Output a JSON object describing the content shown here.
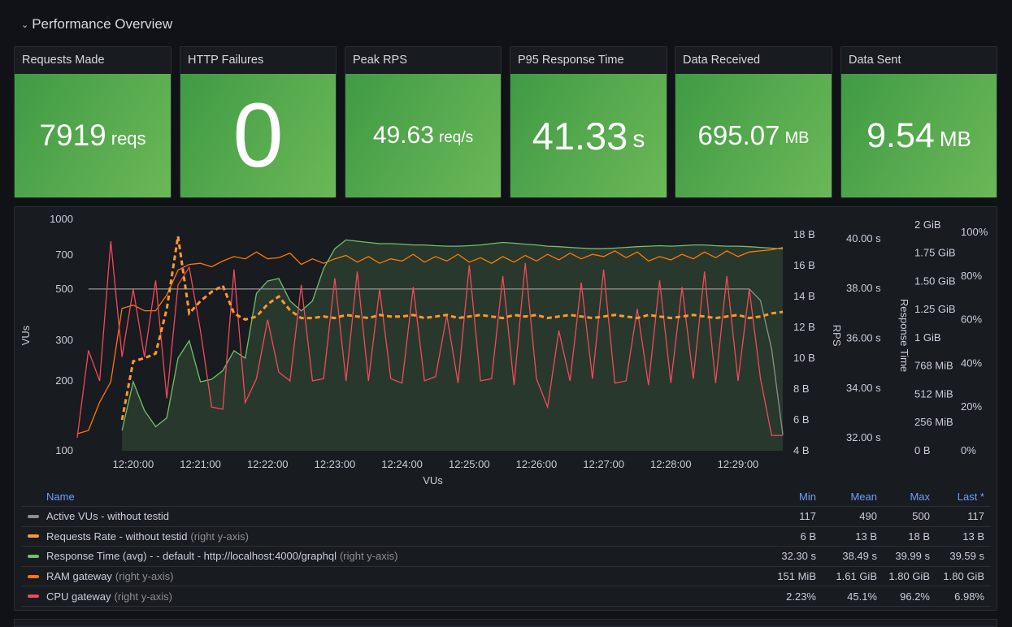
{
  "row": {
    "title": "Performance Overview",
    "icon": "chevron-down-icon"
  },
  "stats": [
    {
      "title": "Requests Made",
      "value": "7919",
      "unit": "reqs"
    },
    {
      "title": "HTTP Failures",
      "value": "0",
      "unit": ""
    },
    {
      "title": "Peak RPS",
      "value": "49.63",
      "unit": "req/s"
    },
    {
      "title": "P95 Response Time",
      "value": "41.33",
      "unit": "s"
    },
    {
      "title": "Data Received",
      "value": "695.07",
      "unit": "MB"
    },
    {
      "title": "Data Sent",
      "value": "9.54",
      "unit": "MB"
    }
  ],
  "colors": {
    "stat_green": "#56a94e",
    "vus": "#8e8e8e",
    "rps": "#FF9830",
    "resp": "#73BF69",
    "ram": "#FF780A",
    "cpu": "#F2495C",
    "legend_header": "#6e9fff"
  },
  "chart_data": {
    "type": "line",
    "xlabel": "VUs",
    "xlim": [
      "12:19:10",
      "12:29:45"
    ],
    "xticks": [
      "12:20:00",
      "12:21:00",
      "12:22:00",
      "12:23:00",
      "12:24:00",
      "12:25:00",
      "12:26:00",
      "12:27:00",
      "12:28:00",
      "12:29:00"
    ],
    "axes": {
      "vus": {
        "label": "VUs",
        "scale": "log",
        "range": [
          100,
          1000
        ],
        "ticks": [
          {
            "v": 100,
            "t": "100"
          },
          {
            "v": 200,
            "t": "200"
          },
          {
            "v": 300,
            "t": "300"
          },
          {
            "v": 500,
            "t": "500"
          },
          {
            "v": 700,
            "t": "700"
          },
          {
            "v": 1000,
            "t": "1000"
          }
        ]
      },
      "rps": {
        "label": "RPS",
        "range": [
          4,
          19
        ],
        "ticks": [
          {
            "v": 4,
            "t": "4 B"
          },
          {
            "v": 6,
            "t": "6 B"
          },
          {
            "v": 8,
            "t": "8 B"
          },
          {
            "v": 10,
            "t": "10 B"
          },
          {
            "v": 12,
            "t": "12 B"
          },
          {
            "v": 14,
            "t": "14 B"
          },
          {
            "v": 16,
            "t": "16 B"
          },
          {
            "v": 18,
            "t": "18 B"
          }
        ]
      },
      "resp": {
        "label": "Response Time",
        "range": [
          31.48,
          40.78
        ],
        "ticks": [
          {
            "v": 32,
            "t": "32.00 s"
          },
          {
            "v": 34,
            "t": "34.00 s"
          },
          {
            "v": 36,
            "t": "36.00 s"
          },
          {
            "v": 38,
            "t": "38.00 s"
          },
          {
            "v": 40,
            "t": "40.00 s"
          }
        ]
      },
      "ram": {
        "label": "",
        "range": [
          0,
          2.05
        ],
        "ticks": [
          {
            "v": 0,
            "t": "0 B"
          },
          {
            "v": 0.25,
            "t": "256 MiB"
          },
          {
            "v": 0.5,
            "t": "512 MiB"
          },
          {
            "v": 0.75,
            "t": "768 MiB"
          },
          {
            "v": 1,
            "t": "1 GiB"
          },
          {
            "v": 1.25,
            "t": "1.25 GiB"
          },
          {
            "v": 1.5,
            "t": "1.50 GiB"
          },
          {
            "v": 1.75,
            "t": "1.75 GiB"
          },
          {
            "v": 2,
            "t": "2 GiB"
          }
        ]
      },
      "cpu": {
        "label": "",
        "range": [
          0,
          106
        ],
        "ticks": [
          {
            "v": 0,
            "t": "0%"
          },
          {
            "v": 20,
            "t": "20%"
          },
          {
            "v": 40,
            "t": "40%"
          },
          {
            "v": 60,
            "t": "60%"
          },
          {
            "v": 80,
            "t": "80%"
          },
          {
            "v": 100,
            "t": "100%"
          }
        ]
      }
    },
    "x": [
      "12:19:10",
      "12:19:20",
      "12:19:30",
      "12:19:40",
      "12:19:50",
      "12:20:00",
      "12:20:10",
      "12:20:20",
      "12:20:30",
      "12:20:40",
      "12:20:50",
      "12:21:00",
      "12:21:10",
      "12:21:20",
      "12:21:30",
      "12:21:40",
      "12:21:50",
      "12:22:00",
      "12:22:10",
      "12:22:20",
      "12:22:30",
      "12:22:40",
      "12:22:50",
      "12:23:00",
      "12:23:10",
      "12:23:20",
      "12:23:30",
      "12:23:40",
      "12:23:50",
      "12:24:00",
      "12:24:10",
      "12:24:20",
      "12:24:30",
      "12:24:40",
      "12:24:50",
      "12:25:00",
      "12:25:10",
      "12:25:20",
      "12:25:30",
      "12:25:40",
      "12:25:50",
      "12:26:00",
      "12:26:10",
      "12:26:20",
      "12:26:30",
      "12:26:40",
      "12:26:50",
      "12:27:00",
      "12:27:10",
      "12:27:20",
      "12:27:30",
      "12:27:40",
      "12:27:50",
      "12:28:00",
      "12:28:10",
      "12:28:20",
      "12:28:30",
      "12:28:40",
      "12:28:50",
      "12:29:00",
      "12:29:10",
      "12:29:20",
      "12:29:30",
      "12:29:40"
    ],
    "series": [
      {
        "name": "Active VUs - without testid",
        "axis": "vus",
        "style": "line",
        "values": [
          null,
          500,
          500,
          500,
          500,
          500,
          500,
          500,
          500,
          500,
          500,
          500,
          500,
          500,
          500,
          500,
          500,
          500,
          500,
          500,
          500,
          500,
          500,
          500,
          500,
          500,
          500,
          500,
          500,
          500,
          500,
          500,
          500,
          500,
          500,
          500,
          500,
          500,
          500,
          500,
          500,
          500,
          500,
          500,
          500,
          500,
          500,
          500,
          500,
          500,
          500,
          500,
          500,
          500,
          500,
          500,
          500,
          500,
          500,
          500,
          500,
          446,
          275,
          117
        ]
      },
      {
        "name": "Requests Rate - without testid",
        "axis": "rps",
        "style": "dashed",
        "values": [
          null,
          null,
          null,
          null,
          6.0,
          9.8,
          10.0,
          10.3,
          13.2,
          17.9,
          12.9,
          13.7,
          14.3,
          14.7,
          12.9,
          12.5,
          12.7,
          13.5,
          14.0,
          13.1,
          12.6,
          12.6,
          12.7,
          12.6,
          12.8,
          12.7,
          12.6,
          12.8,
          12.7,
          12.7,
          12.8,
          12.6,
          12.7,
          12.8,
          12.6,
          12.7,
          12.8,
          12.7,
          12.6,
          12.8,
          12.7,
          12.8,
          12.6,
          12.7,
          12.8,
          12.7,
          12.6,
          12.7,
          12.8,
          12.7,
          12.6,
          12.8,
          12.7,
          12.6,
          12.7,
          12.8,
          12.7,
          12.6,
          12.7,
          12.8,
          12.6,
          12.7,
          12.9,
          13.0
        ]
      },
      {
        "name": "Response Time (avg) - - default - http://localhost:4000/graphql",
        "axis": "resp",
        "style": "area",
        "values": [
          null,
          null,
          null,
          null,
          32.3,
          34.25,
          33.1,
          32.45,
          32.8,
          35.2,
          35.9,
          34.25,
          34.35,
          34.7,
          35.5,
          35.2,
          37.8,
          38.3,
          38.4,
          37.5,
          37.1,
          37.5,
          38.8,
          39.6,
          39.95,
          39.9,
          39.85,
          39.8,
          39.8,
          39.78,
          39.75,
          39.75,
          39.72,
          39.7,
          39.7,
          39.72,
          39.75,
          39.8,
          39.85,
          39.82,
          39.78,
          39.75,
          39.7,
          39.68,
          39.65,
          39.62,
          39.6,
          39.6,
          39.62,
          39.65,
          39.68,
          39.7,
          39.72,
          39.7,
          39.72,
          39.75,
          39.75,
          39.72,
          39.7,
          39.7,
          39.68,
          39.65,
          39.62,
          39.59
        ]
      },
      {
        "name": "RAM gateway",
        "axis": "ram",
        "style": "line",
        "values": [
          0.15,
          0.18,
          0.43,
          0.61,
          1.26,
          1.29,
          1.24,
          1.24,
          1.38,
          1.6,
          1.65,
          1.66,
          1.63,
          1.68,
          1.72,
          1.7,
          1.76,
          1.7,
          1.71,
          1.75,
          1.65,
          1.7,
          1.66,
          1.7,
          1.73,
          1.67,
          1.72,
          1.66,
          1.7,
          1.68,
          1.74,
          1.67,
          1.72,
          1.68,
          1.74,
          1.67,
          1.71,
          1.66,
          1.72,
          1.67,
          1.73,
          1.68,
          1.74,
          1.69,
          1.75,
          1.7,
          1.74,
          1.72,
          1.77,
          1.71,
          1.76,
          1.68,
          1.72,
          1.69,
          1.74,
          1.7,
          1.76,
          1.71,
          1.77,
          1.72,
          1.76,
          1.77,
          1.78,
          1.8
        ]
      },
      {
        "name": "CPU gateway",
        "axis": "cpu",
        "style": "line",
        "values": [
          6,
          46,
          32,
          96,
          43,
          74,
          43,
          78,
          24,
          76,
          84,
          55,
          20,
          19,
          83,
          22,
          33,
          60,
          36,
          32,
          76,
          32,
          33,
          79,
          32,
          82,
          32,
          74,
          33,
          31,
          75,
          32,
          34,
          62,
          31,
          85,
          32,
          33,
          80,
          30,
          86,
          33,
          20,
          55,
          32,
          77,
          33,
          83,
          31,
          32,
          65,
          30,
          78,
          31,
          75,
          33,
          82,
          31,
          80,
          32,
          74,
          33,
          7,
          6.98
        ]
      }
    ],
    "grid": false,
    "legend": "bottom"
  },
  "legend": {
    "headers": {
      "name": "Name",
      "min": "Min",
      "mean": "Mean",
      "max": "Max",
      "last": "Last *"
    },
    "rows": [
      {
        "name": "Active VUs - without testid",
        "note": "",
        "color": "#8e8e8e",
        "min": "117",
        "mean": "490",
        "max": "500",
        "last": "117"
      },
      {
        "name": "Requests Rate - without testid",
        "note": "(right y-axis)",
        "color": "#FF9830",
        "min": "6 B",
        "mean": "13 B",
        "max": "18 B",
        "last": "13 B"
      },
      {
        "name": "Response Time (avg) - - default - http://localhost:4000/graphql",
        "note": "(right y-axis)",
        "color": "#73BF69",
        "min": "32.30 s",
        "mean": "38.49 s",
        "max": "39.99 s",
        "last": "39.59 s"
      },
      {
        "name": "RAM gateway",
        "note": "(right y-axis)",
        "color": "#FF780A",
        "min": "151 MiB",
        "mean": "1.61 GiB",
        "max": "1.80 GiB",
        "last": "1.80 GiB"
      },
      {
        "name": "CPU gateway",
        "note": "(right y-axis)",
        "color": "#F2495C",
        "min": "2.23%",
        "mean": "45.1%",
        "max": "96.2%",
        "last": "6.98%"
      }
    ]
  }
}
